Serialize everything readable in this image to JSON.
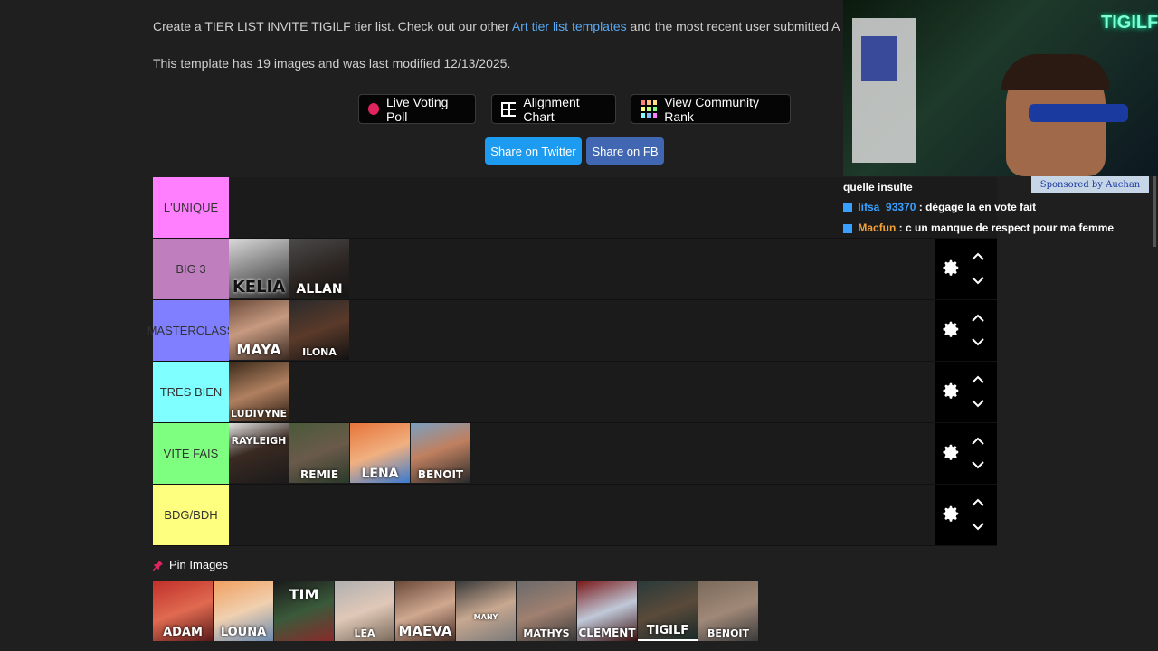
{
  "intro": {
    "prefix": "Create a TIER LIST INVITE TIGILF tier list. Check out our other ",
    "link": "Art tier list templates",
    "suffix": " and the most recent user submitted A",
    "meta": "This template has 19 images and was last modified 12/13/2025."
  },
  "buttons": {
    "live_voting": "Live Voting Poll",
    "alignment": "Alignment Chart",
    "community": "View Community Rank",
    "twitter": "Share on Twitter",
    "fb": "Share on FB"
  },
  "colors": {
    "s": "#ff7fff",
    "a": "#bf7fbf",
    "b": "#7f7fff",
    "c": "#7fffff",
    "d": "#7fff7f",
    "e": "#ffff7f",
    "twitter": "#1d9bf0",
    "fb": "#4267b2",
    "link": "#5aa9f2"
  },
  "tiers": [
    {
      "label": "L'UNIQUE",
      "items": []
    },
    {
      "label": "BIG 3",
      "items": [
        "KELIA",
        "ALLAN"
      ]
    },
    {
      "label": "MASTERCLASS",
      "items": [
        "MAYA",
        "ILONA"
      ]
    },
    {
      "label": "TRES BIEN",
      "items": [
        "LUDIVYNE"
      ]
    },
    {
      "label": "VITE FAIS",
      "items": [
        "RAYLEIGH",
        "REMIE",
        "LENA",
        "BENOIT"
      ]
    },
    {
      "label": "BDG/BDH",
      "items": []
    }
  ],
  "pin": {
    "title": "Pin Images",
    "items": [
      "ADAM",
      "LOUNA",
      "TIM",
      "LEA",
      "MAEVA",
      "MANY",
      "MATHYS",
      "CLEMENT",
      "TIGILF",
      "BENOIT"
    ]
  },
  "stream": {
    "cam_label": "TIGILF",
    "sponsor": "Sponsored by Auchan",
    "chat": [
      {
        "user": "",
        "text": "quelle insulte"
      },
      {
        "user": "lifsa_93370",
        "text": " : dégage la en vote fait"
      },
      {
        "user": "Macfun",
        "text": " : c un manque de respect pour ma femme"
      }
    ]
  },
  "icons": [
    "pin-icon",
    "gear-icon",
    "chevron-up-icon",
    "chevron-down-icon",
    "grid-icon",
    "color-grid-icon"
  ]
}
